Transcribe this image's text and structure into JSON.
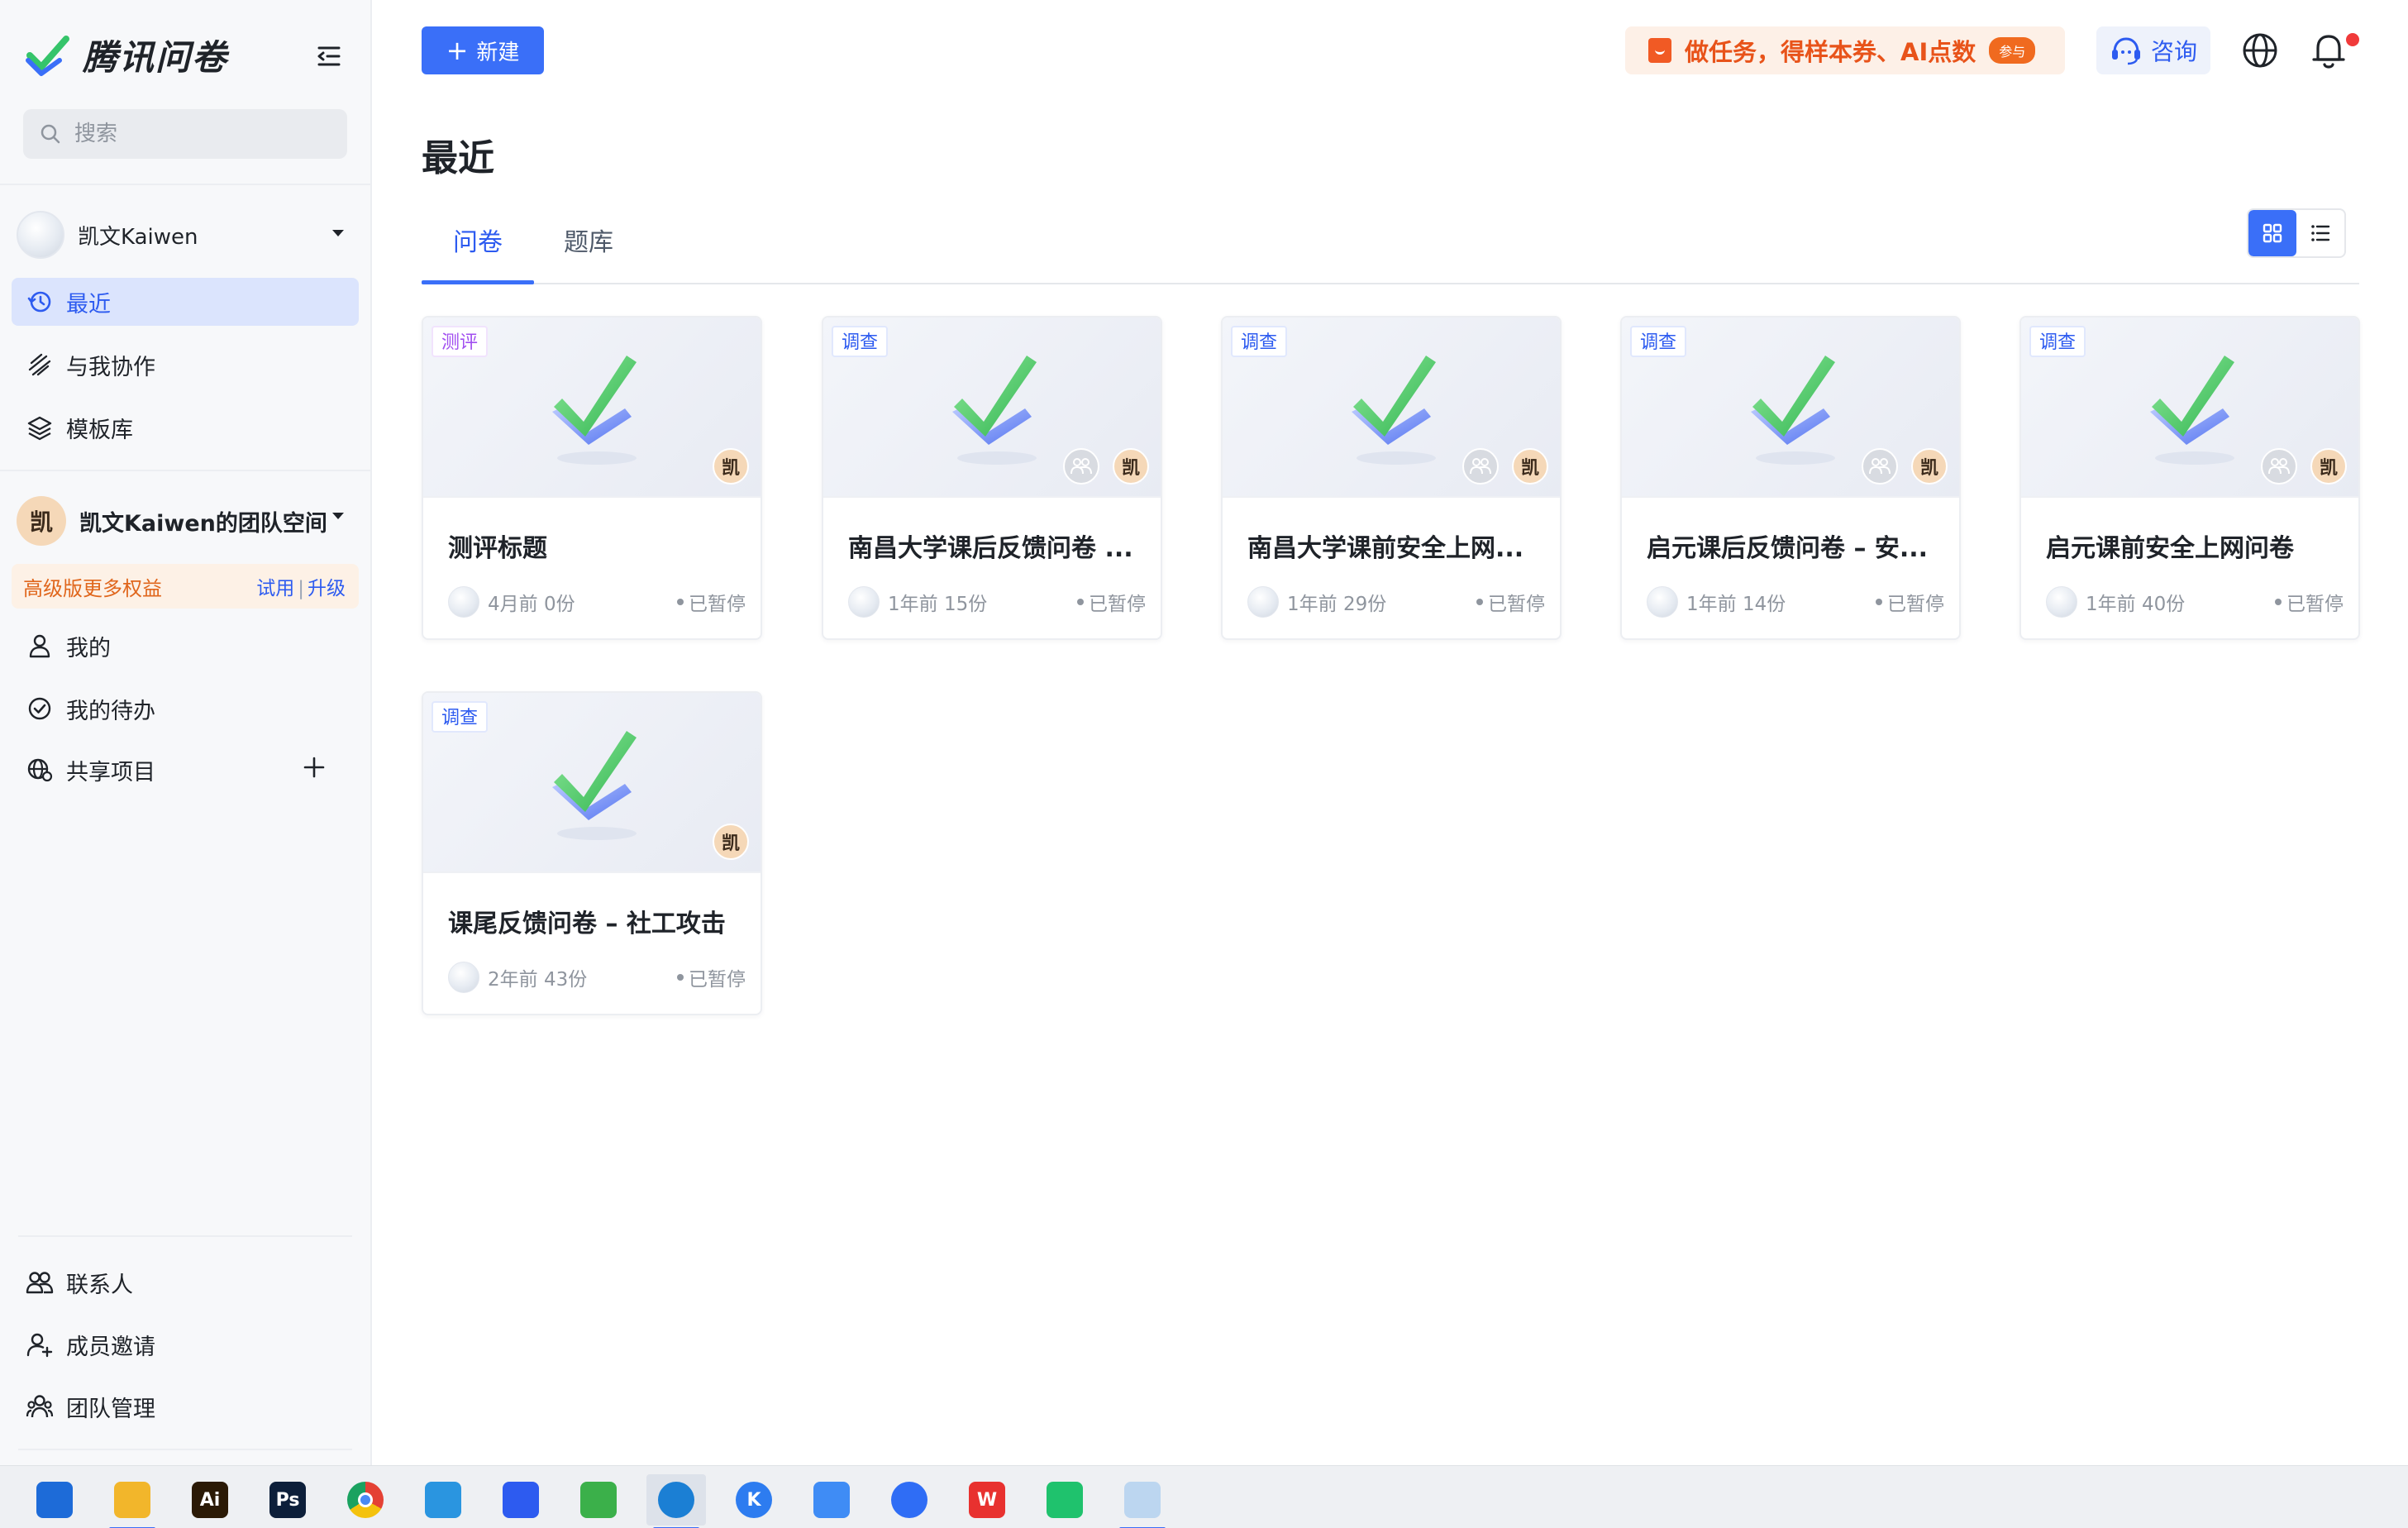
{
  "app": {
    "name": "腾讯问卷"
  },
  "sidebar": {
    "search_placeholder": "搜索",
    "account_name": "凯文Kaiwen",
    "nav_primary": [
      {
        "label": "最近",
        "icon": "history-icon",
        "active": true
      },
      {
        "label": "与我协作",
        "icon": "collaborate-icon",
        "active": false
      },
      {
        "label": "模板库",
        "icon": "layers-icon",
        "active": false
      }
    ],
    "team": {
      "avatar_char": "凯",
      "name": "凯文Kaiwen的团队空间"
    },
    "upsell": {
      "text": "高级版更多权益",
      "trial": "试用",
      "separator": "|",
      "upgrade": "升级"
    },
    "nav_team": [
      {
        "label": "我的",
        "icon": "user-icon"
      },
      {
        "label": "我的待办",
        "icon": "check-circle-icon"
      },
      {
        "label": "共享项目",
        "icon": "shared-globe-icon"
      }
    ],
    "nav_bottom": [
      {
        "label": "联系人",
        "icon": "contacts-icon"
      },
      {
        "label": "成员邀请",
        "icon": "add-member-icon"
      },
      {
        "label": "团队管理",
        "icon": "team-manage-icon"
      }
    ]
  },
  "header": {
    "new_button": "新建",
    "promo_text": "做任务，得样本券、AI点数",
    "promo_badge": "参与",
    "consult": "咨询"
  },
  "main": {
    "title": "最近",
    "tabs": [
      {
        "label": "问卷",
        "active": true
      },
      {
        "label": "题库",
        "active": false
      }
    ],
    "view_mode": "grid"
  },
  "cards": [
    {
      "tag": "测评",
      "tag_color": "purple",
      "title": "测评标题",
      "meta": "4月前 0份",
      "status": "已暂停",
      "has_collaborator": false,
      "owner": "凯"
    },
    {
      "tag": "调查",
      "tag_color": "blue",
      "title": "南昌大学课后反馈问卷 ...",
      "meta": "1年前 15份",
      "status": "已暂停",
      "has_collaborator": true,
      "owner": "凯"
    },
    {
      "tag": "调查",
      "tag_color": "blue",
      "title": "南昌大学课前安全上网...",
      "meta": "1年前 29份",
      "status": "已暂停",
      "has_collaborator": true,
      "owner": "凯"
    },
    {
      "tag": "调查",
      "tag_color": "blue",
      "title": "启元课后反馈问卷 – 安...",
      "meta": "1年前 14份",
      "status": "已暂停",
      "has_collaborator": true,
      "owner": "凯"
    },
    {
      "tag": "调查",
      "tag_color": "blue",
      "title": "启元课前安全上网问卷",
      "meta": "1年前 40份",
      "status": "已暂停",
      "has_collaborator": true,
      "owner": "凯"
    },
    {
      "tag": "调查",
      "tag_color": "blue",
      "title": "课尾反馈问卷 – 社工攻击",
      "meta": "2年前 43份",
      "status": "已暂停",
      "has_collaborator": false,
      "owner": "凯"
    }
  ],
  "taskbar": [
    {
      "name": "shield-app-icon",
      "color": "#1d6bd8"
    },
    {
      "name": "file-explorer-icon",
      "color": "#f2b62b"
    },
    {
      "name": "illustrator-icon",
      "color": "#2b1a06",
      "text": "Ai"
    },
    {
      "name": "photoshop-icon",
      "color": "#0d1f3a",
      "text": "Ps"
    },
    {
      "name": "chrome-icon",
      "color": "#e44134"
    },
    {
      "name": "ie-icon",
      "color": "#2a95e0"
    },
    {
      "name": "feishu-icon",
      "color": "#2d5bf0"
    },
    {
      "name": "edge-green-icon",
      "color": "#3bb04a"
    },
    {
      "name": "edge-icon",
      "color": "#1b7fd4",
      "active": true
    },
    {
      "name": "k-app-icon",
      "color": "#2d7cf0",
      "text": "K"
    },
    {
      "name": "lanhu-icon",
      "color": "#3f8cf5"
    },
    {
      "name": "chat-bubble-icon",
      "color": "#2f6df5"
    },
    {
      "name": "wps-icon",
      "color": "#e8312f",
      "text": "W"
    },
    {
      "name": "shopping-bag-icon",
      "color": "#1fc26d"
    },
    {
      "name": "avatar-app-icon",
      "color": "#bcd6f0",
      "active_indicator": true
    }
  ]
}
